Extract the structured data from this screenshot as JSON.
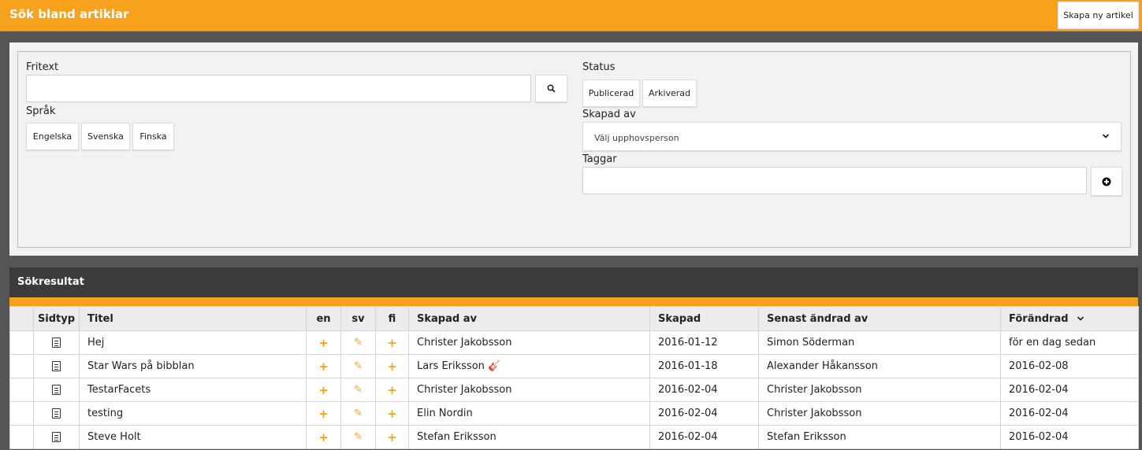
{
  "header": {
    "title": "Sök bland artiklar",
    "create_label": "Skapa ny artikel"
  },
  "filters": {
    "fritext_label": "Fritext",
    "fritext_value": "",
    "search_icon": "search-icon",
    "sprak_label": "Språk",
    "languages": [
      "Engelska",
      "Svenska",
      "Finska"
    ],
    "status_label": "Status",
    "statuses": [
      "Publicerad",
      "Arkiverad"
    ],
    "skapad_av_label": "Skapad av",
    "skapad_av_placeholder": "Välj upphovsperson",
    "taggar_label": "Taggar",
    "taggar_value": "",
    "add_tag_icon": "plus-circle-icon"
  },
  "results": {
    "title": "Sökresultat",
    "columns": [
      "",
      "Sidtyp",
      "Titel",
      "en",
      "sv",
      "fi",
      "Skapad av",
      "Skapad",
      "Senast ändrad av",
      "Förändrad"
    ],
    "sort_column": "Förändrad",
    "sort_icon": "chevron-down-icon",
    "rows": [
      {
        "title": "Hej",
        "en": "+",
        "sv": "✎",
        "fi": "+",
        "created_by": "Christer Jakobsson",
        "created_by_icon": "",
        "created": "2016-01-12",
        "modified_by": "Simon Söderman",
        "modified": "för en dag sedan"
      },
      {
        "title": "Star Wars på bibblan",
        "en": "+",
        "sv": "✎",
        "fi": "+",
        "created_by": "Lars Eriksson",
        "created_by_icon": "guitar-icon",
        "created": "2016-01-18",
        "modified_by": "Alexander Håkansson",
        "modified": "2016-02-08"
      },
      {
        "title": "TestarFacets",
        "en": "+",
        "sv": "✎",
        "fi": "+",
        "created_by": "Christer Jakobsson",
        "created_by_icon": "",
        "created": "2016-02-04",
        "modified_by": "Christer Jakobsson",
        "modified": "2016-02-04"
      },
      {
        "title": "testing",
        "en": "+",
        "sv": "✎",
        "fi": "+",
        "created_by": "Elin Nordin",
        "created_by_icon": "",
        "created": "2016-02-04",
        "modified_by": "Christer Jakobsson",
        "modified": "2016-02-04"
      },
      {
        "title": "Steve Holt",
        "en": "+",
        "sv": "✎",
        "fi": "+",
        "created_by": "Stefan Eriksson",
        "created_by_icon": "",
        "created": "2016-02-04",
        "modified_by": "Stefan Eriksson",
        "modified": "2016-02-04"
      }
    ]
  },
  "colors": {
    "accent": "#f7a21d",
    "dark_header": "#3b3b3b",
    "background": "#555555"
  }
}
